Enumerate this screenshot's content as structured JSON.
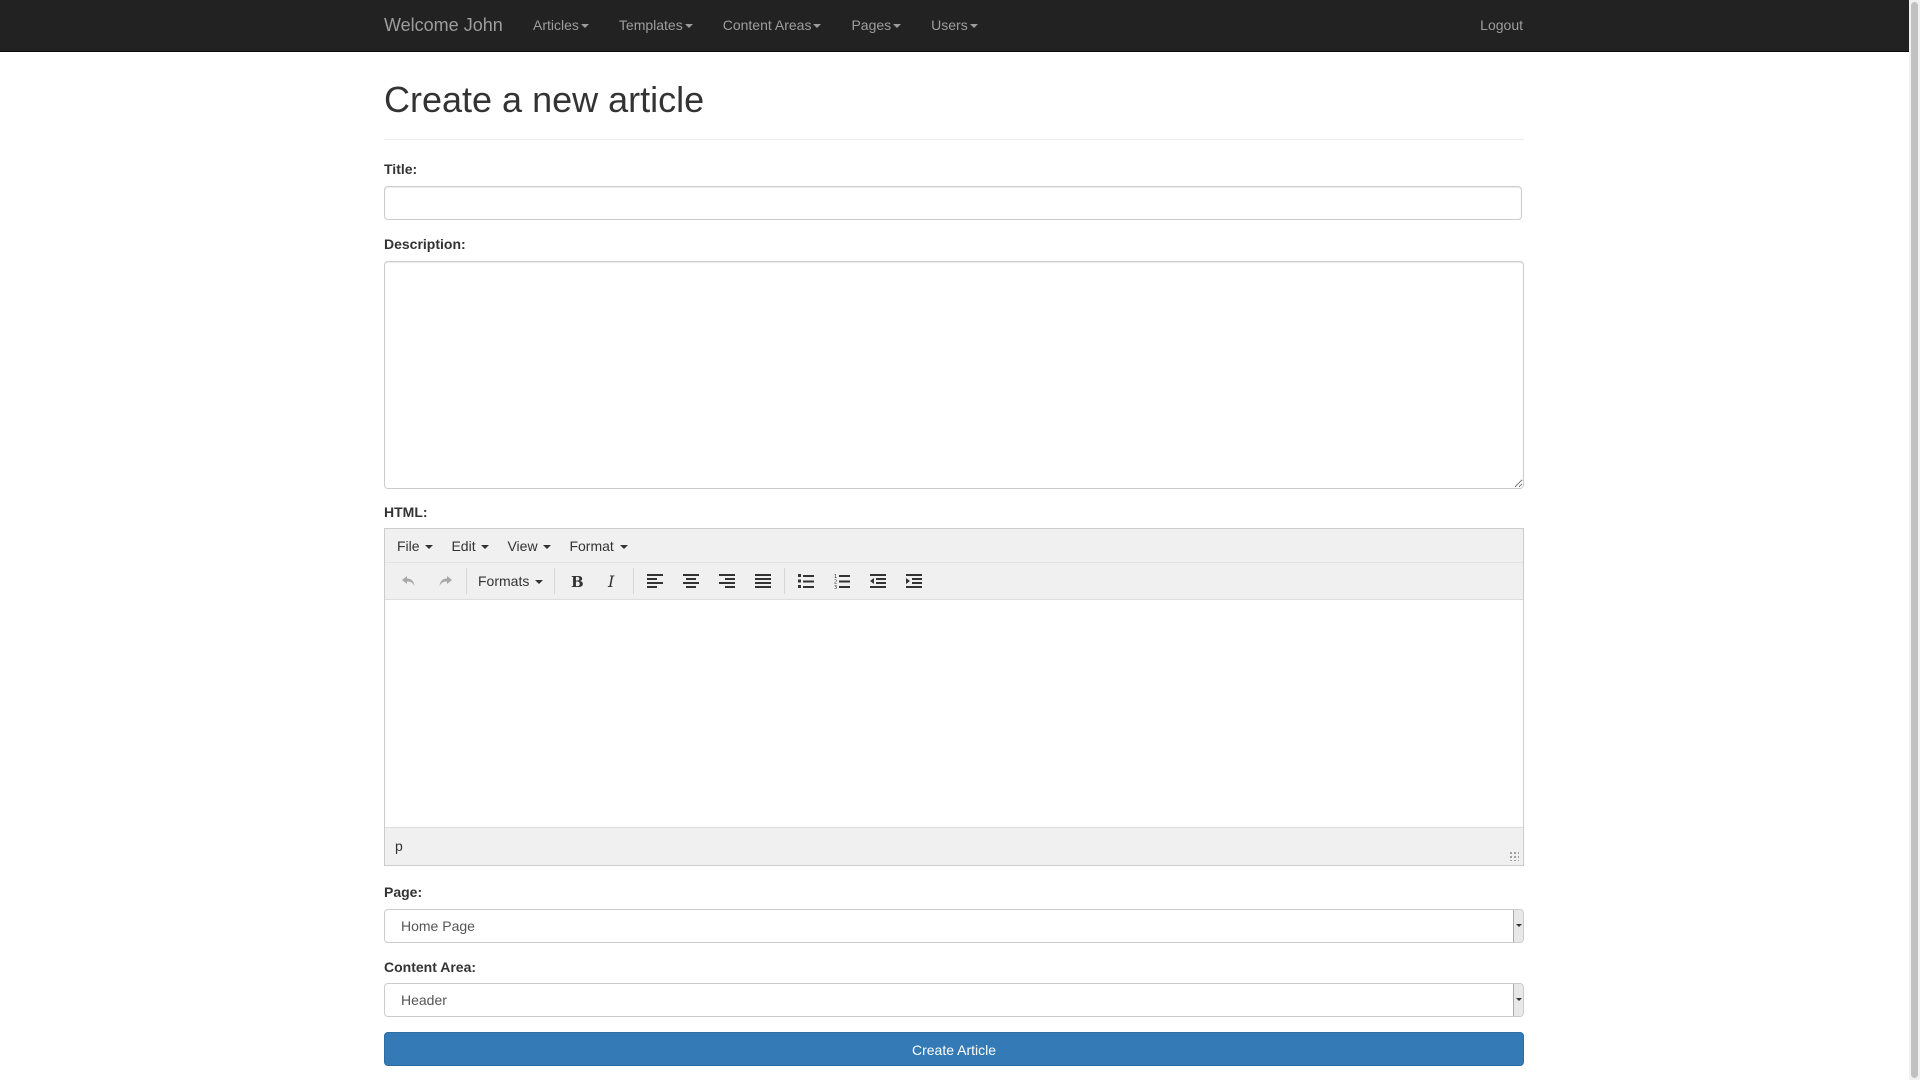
{
  "navbar": {
    "brand": "Welcome John",
    "items": [
      {
        "label": "Articles"
      },
      {
        "label": "Templates"
      },
      {
        "label": "Content Areas"
      },
      {
        "label": "Pages"
      },
      {
        "label": "Users"
      }
    ],
    "logout": "Logout"
  },
  "page": {
    "title": "Create a new article"
  },
  "form": {
    "title_label": "Title:",
    "title_value": "",
    "description_label": "Description:",
    "description_value": "",
    "html_label": "HTML:",
    "page_label": "Page:",
    "page_value": "Home Page",
    "content_area_label": "Content Area:",
    "content_area_value": "Header",
    "submit_label": "Create Article"
  },
  "editor": {
    "menu": [
      {
        "label": "File"
      },
      {
        "label": "Edit"
      },
      {
        "label": "View"
      },
      {
        "label": "Format"
      }
    ],
    "formats_label": "Formats",
    "status_path": "p",
    "toolbar_icons": [
      "undo-icon",
      "redo-icon",
      "bold-icon",
      "italic-icon",
      "align-left-icon",
      "align-center-icon",
      "align-right-icon",
      "align-justify-icon",
      "bullet-list-icon",
      "numbered-list-icon",
      "outdent-icon",
      "indent-icon"
    ]
  },
  "colors": {
    "navbar_bg": "#222222",
    "navbar_text": "#9d9d9d",
    "primary": "#337ab7"
  }
}
